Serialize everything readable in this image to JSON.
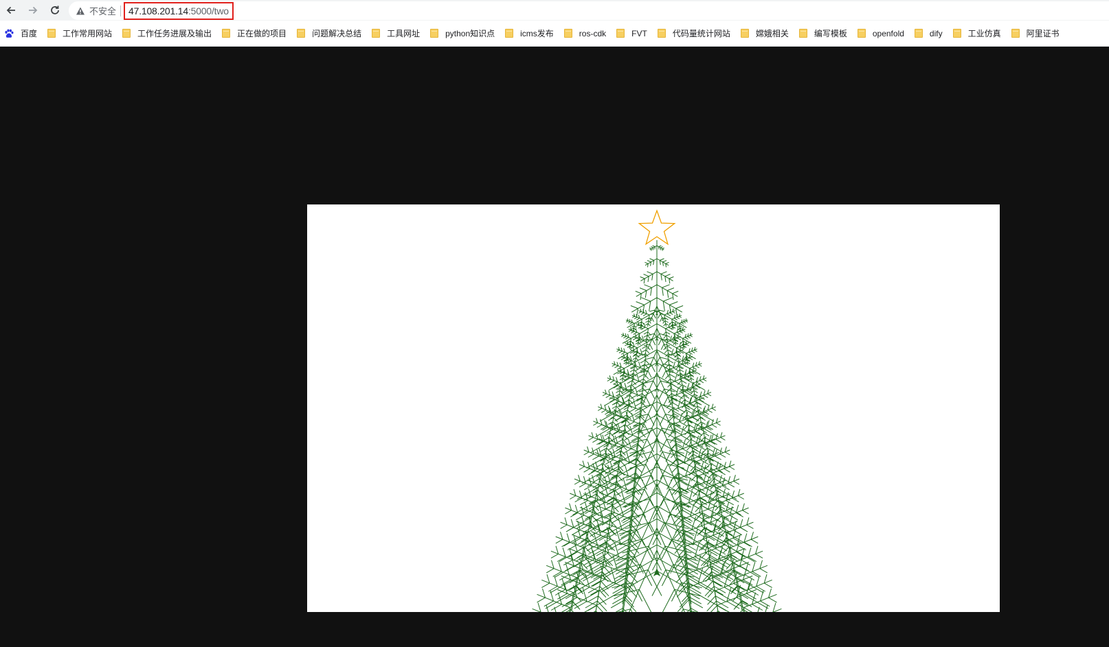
{
  "browser": {
    "security_label": "不安全",
    "url_host": "47.108.201.14",
    "url_path": ":5000/two",
    "icons": {
      "back": "back-arrow-icon",
      "forward": "forward-arrow-icon",
      "reload": "reload-icon",
      "warning": "warning-triangle-icon"
    }
  },
  "bookmarks": [
    {
      "label": "百度",
      "icon": "paw-icon"
    },
    {
      "label": "工作常用网站",
      "icon": "folder-icon"
    },
    {
      "label": "工作任务进展及输出",
      "icon": "folder-icon"
    },
    {
      "label": "正在做的项目",
      "icon": "folder-icon"
    },
    {
      "label": "问题解决总结",
      "icon": "folder-icon"
    },
    {
      "label": "工具网址",
      "icon": "folder-icon"
    },
    {
      "label": "python知识点",
      "icon": "folder-icon"
    },
    {
      "label": "icms发布",
      "icon": "folder-icon"
    },
    {
      "label": "ros-cdk",
      "icon": "folder-icon"
    },
    {
      "label": "FVT",
      "icon": "folder-icon"
    },
    {
      "label": "代码量统计网站",
      "icon": "folder-icon"
    },
    {
      "label": "嫦娥相关",
      "icon": "folder-icon"
    },
    {
      "label": "编写模板",
      "icon": "folder-icon"
    },
    {
      "label": "openfold",
      "icon": "folder-icon"
    },
    {
      "label": "dify",
      "icon": "folder-icon"
    },
    {
      "label": "工业仿真",
      "icon": "folder-icon"
    },
    {
      "label": "阿里证书",
      "icon": "folder-icon"
    }
  ],
  "drawing": {
    "subject": "fractal christmas tree with star on top",
    "colors": {
      "page_background": "#111111",
      "canvas_background": "#ffffff",
      "tree": "#1e6b1e",
      "star": "#f0a000"
    },
    "icons": {
      "star": "star-icon",
      "turtle": "turtle-cursor-icon"
    }
  }
}
